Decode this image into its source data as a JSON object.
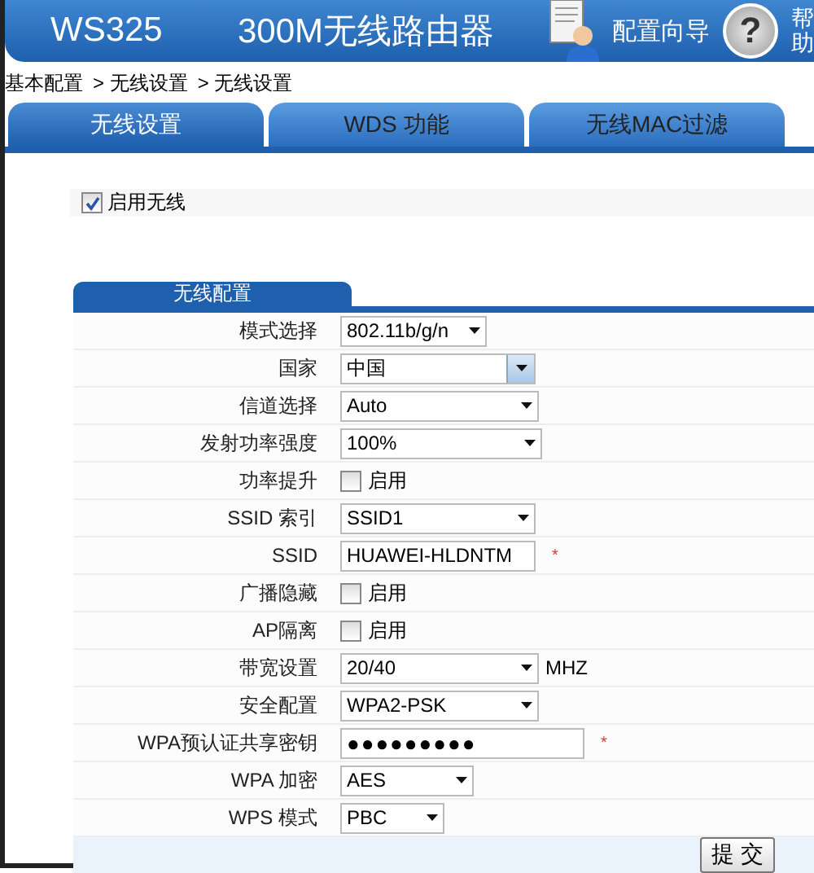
{
  "header": {
    "model": "WS325",
    "title": "300M无线路由器",
    "wizard": "配置向导",
    "help_symbol": "?",
    "help": "帮助"
  },
  "breadcrumb": [
    "基本配置",
    "> 无线设置",
    "> 无线设置"
  ],
  "tabs": [
    {
      "label": "无线设置",
      "selected": true
    },
    {
      "label": "WDS 功能",
      "selected": false
    },
    {
      "label": "无线MAC过滤",
      "selected": false
    }
  ],
  "enable_wireless": {
    "label": "启用无线",
    "checked": true
  },
  "section": {
    "title": "无线配置"
  },
  "fields": [
    {
      "label": "模式选择",
      "kind": "select",
      "value": "802.11b/g/n"
    },
    {
      "label": "国家",
      "kind": "combo",
      "value": "中国"
    },
    {
      "label": "信道选择",
      "kind": "select",
      "value": "Auto"
    },
    {
      "label": "发射功率强度",
      "kind": "select",
      "value": "100%"
    },
    {
      "label": "功率提升",
      "kind": "checkbox",
      "value": "启用",
      "checked": false
    },
    {
      "label": "SSID 索引",
      "kind": "select",
      "value": "SSID1"
    },
    {
      "label": "SSID",
      "kind": "text",
      "value": "HUAWEI-HLDNTM",
      "required": true
    },
    {
      "label": "广播隐藏",
      "kind": "checkbox",
      "value": "启用",
      "checked": false
    },
    {
      "label": "AP隔离",
      "kind": "checkbox",
      "value": "启用",
      "checked": false
    },
    {
      "label": "带宽设置",
      "kind": "select",
      "value": "20/40",
      "suffix": "MHZ"
    },
    {
      "label": "安全配置",
      "kind": "select",
      "value": "WPA2-PSK"
    },
    {
      "label": "WPA预认证共享密钥",
      "kind": "password",
      "value": "●●●●●●●●●",
      "required": true
    },
    {
      "label": "WPA 加密",
      "kind": "select",
      "value": "AES"
    },
    {
      "label": "WPS 模式",
      "kind": "select",
      "value": "PBC"
    }
  ],
  "required_mark": "*",
  "submit": "提 交"
}
